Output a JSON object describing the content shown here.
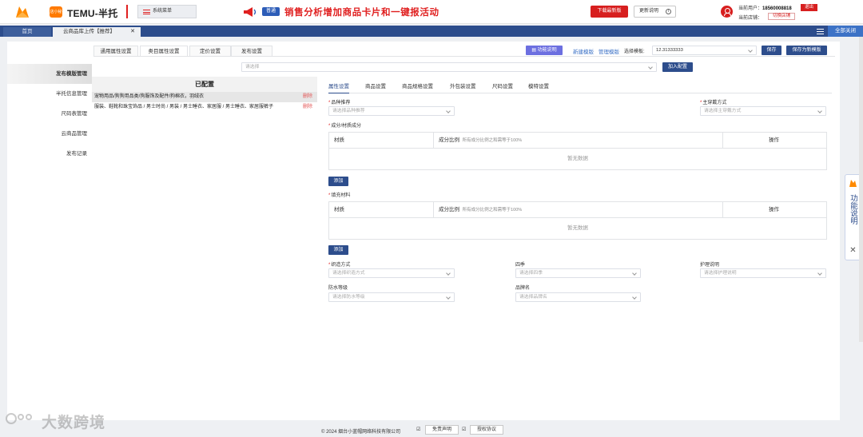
{
  "header": {
    "brand": "TEMU-半托",
    "brand_badge": "店小秘",
    "system_menu": "系统菜单",
    "notice_tag": "普通",
    "notice": "销售分析增加商品卡片和一键报活动",
    "download_btn": "下载最新版",
    "update_btn": "更新说明",
    "user_label": "当前用户：",
    "user_value": "18560008818",
    "logout": "退出",
    "store_label": "当前店铺：",
    "store_btn": "切换店铺"
  },
  "tabs": {
    "home": "首页",
    "active": "云商品库上传【推荐】",
    "close_all": "全部关闭"
  },
  "left_nav": [
    "发布模版管理",
    "半托信息管理",
    "尺码表管理",
    "云商品管理",
    "发布记录"
  ],
  "sub_tabs": [
    "通用属性设置",
    "类目属性设置",
    "定价设置",
    "发布设置"
  ],
  "toolbar": {
    "func_desc": "功能说明",
    "new_template": "新建模版",
    "manage_template": "管理模版",
    "select_label": "选择模板:",
    "select_value": "12.31333333",
    "save": "保存",
    "save_as": "保存为新模版"
  },
  "category_select": {
    "placeholder": "请选择",
    "add_btn": "加入配置"
  },
  "configured": {
    "title": "已配置",
    "delete": "删除",
    "rows": [
      "宠物用品/狗狗用品类/狗服饰及配件/狗棉衣，羽绒衣",
      "服装、鞋靴和珠宝饰品 / 男士时尚 / 男装 / 男士睡衣、家居服 / 男士睡衣、家居服裤子"
    ]
  },
  "right_tabs": [
    "属性设置",
    "商品设置",
    "商品规格设置",
    "外包装设置",
    "尺码设置",
    "模特设置"
  ],
  "form": {
    "style_label": "品种推荐",
    "style_ph": "请选择品种推荐",
    "main_wear_label": "主穿戴方式",
    "main_wear_ph": "请选择主穿戴方式",
    "material_label": "成分/材质成分",
    "fill_label": "填充材料",
    "col_material": "材质",
    "col_ratio": "成分比例",
    "col_ratio_hint": "所有成分比例之和需等于100%",
    "col_action": "操作",
    "empty": "暂无数据",
    "add": "添加",
    "weave_label": "织造方式",
    "weave_ph": "请选择织造方式",
    "season_label": "四季",
    "season_ph": "请选择四季",
    "care_label": "护理说明",
    "care_ph": "请选择护理说明",
    "water_label": "防水等级",
    "water_ph": "请选择防水等级",
    "brand_label": "品牌名",
    "brand_ph": "请选择品牌名"
  },
  "float_panel": {
    "text": "功能说明"
  },
  "footer": {
    "copyright": "© 2024 烟台小蓝帽网络科技有限公司",
    "disclaimer": "免责声明",
    "license": "授权协议"
  },
  "watermark": "大数跨境"
}
